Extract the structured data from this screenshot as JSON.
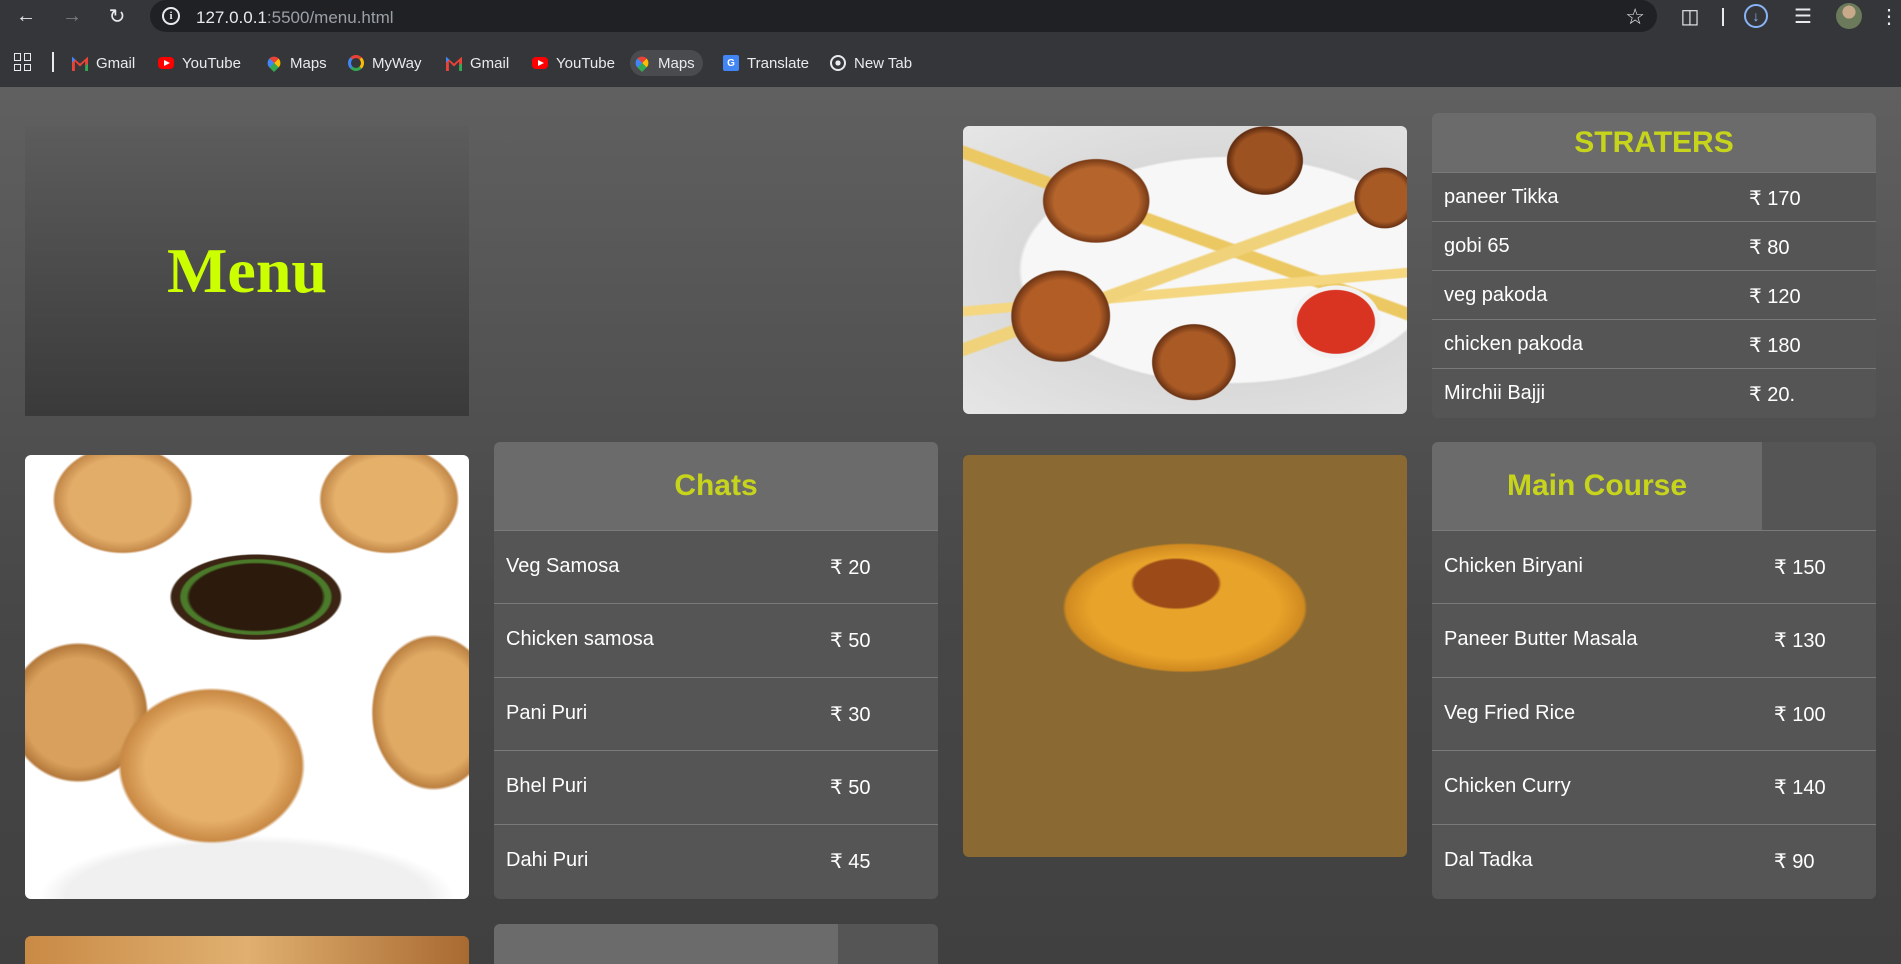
{
  "browser": {
    "url_host": "127.0.0.1",
    "url_rest": ":5500/menu.html",
    "bookmarks": [
      {
        "label": "Gmail",
        "icon": "gmail-icon"
      },
      {
        "label": "YouTube",
        "icon": "youtube-icon"
      },
      {
        "label": "Maps",
        "icon": "maps-icon"
      },
      {
        "label": "MyWay",
        "icon": "myway-icon"
      },
      {
        "label": "Gmail",
        "icon": "gmail-icon"
      },
      {
        "label": "YouTube",
        "icon": "youtube-icon"
      },
      {
        "label": "Maps",
        "icon": "maps-icon"
      },
      {
        "label": "Translate",
        "icon": "translate-icon"
      },
      {
        "label": "New Tab",
        "icon": "globe-icon"
      }
    ]
  },
  "page": {
    "title": "Menu",
    "starters": {
      "heading": "STRATERS",
      "items": [
        {
          "name": "paneer Tikka",
          "price": "₹ 170"
        },
        {
          "name": "gobi 65",
          "price": "₹ 80"
        },
        {
          "name": "veg pakoda",
          "price": "₹ 120"
        },
        {
          "name": "chicken pakoda",
          "price": "₹ 180"
        },
        {
          "name": "Mirchii Bajji",
          "price": "₹ 20."
        }
      ]
    },
    "chats": {
      "heading": "Chats",
      "items": [
        {
          "name": "Veg Samosa",
          "price": "₹ 20"
        },
        {
          "name": "Chicken samosa",
          "price": "₹ 50"
        },
        {
          "name": "Pani Puri",
          "price": "₹ 30"
        },
        {
          "name": "Bhel Puri",
          "price": "₹ 50"
        },
        {
          "name": "Dahi Puri",
          "price": "₹ 45"
        }
      ]
    },
    "main_course": {
      "heading": "Main Course",
      "items": [
        {
          "name": "Chicken Biryani",
          "price": "₹ 150"
        },
        {
          "name": "Paneer Butter Masala",
          "price": "₹ 130"
        },
        {
          "name": "Veg Fried Rice",
          "price": "₹ 100"
        },
        {
          "name": "Chicken Curry",
          "price": "₹ 140"
        },
        {
          "name": "Dal Tadka",
          "price": "₹ 90"
        }
      ]
    }
  },
  "colors": {
    "title": "#ccff00",
    "card_heading": "#c7d41c",
    "card_bg": "#555555",
    "card_head_bg": "#6b6b6b"
  }
}
